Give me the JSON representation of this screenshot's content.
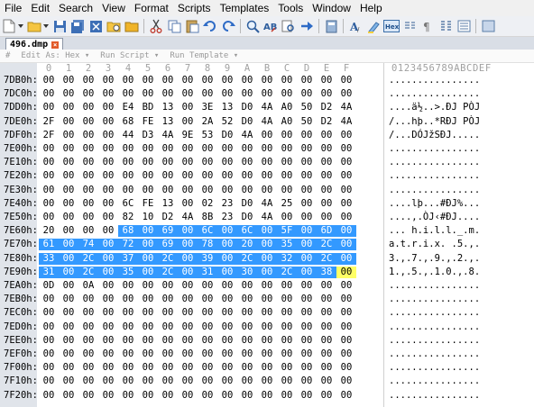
{
  "menu": [
    "File",
    "Edit",
    "Search",
    "View",
    "Format",
    "Scripts",
    "Templates",
    "Tools",
    "Window",
    "Help"
  ],
  "toolbar_icons": [
    "new-file-icon",
    "open-folder-icon",
    "save-icon",
    "save-all-icon",
    "close-file-icon",
    "open-recent-icon",
    "cut-icon",
    "copy-icon",
    "paste-icon",
    "undo-icon",
    "redo-icon",
    "find-icon",
    "replace-icon",
    "find-in-files-icon",
    "goto-icon",
    "calculator-icon",
    "font-icon",
    "highlight-icon",
    "hex-mode-icon",
    "text-mode-icon",
    "show-whitespace-icon",
    "columns-icon",
    "addresses-icon",
    "options-icon"
  ],
  "tab": {
    "label": "496.dmp"
  },
  "template_bar": {
    "edit_as": "Edit As: Hex",
    "run_script": "Run Script",
    "run_template": "Run Template"
  },
  "columns": [
    "0",
    "1",
    "2",
    "3",
    "4",
    "5",
    "6",
    "7",
    "8",
    "9",
    "A",
    "B",
    "C",
    "D",
    "E",
    "F"
  ],
  "ascii_header": "0123456789ABCDEF",
  "rows": [
    {
      "addr": "7DB0h:",
      "bytes": [
        "00",
        "00",
        "00",
        "00",
        "00",
        "00",
        "00",
        "00",
        "00",
        "00",
        "00",
        "00",
        "00",
        "00",
        "00",
        "00"
      ],
      "ascii": "................"
    },
    {
      "addr": "7DC0h:",
      "bytes": [
        "00",
        "00",
        "00",
        "00",
        "00",
        "00",
        "00",
        "00",
        "00",
        "00",
        "00",
        "00",
        "00",
        "00",
        "00",
        "00"
      ],
      "ascii": "................"
    },
    {
      "addr": "7DD0h:",
      "bytes": [
        "00",
        "00",
        "00",
        "00",
        "E4",
        "BD",
        "13",
        "00",
        "3E",
        "13",
        "D0",
        "4A",
        "A0",
        "50",
        "D2",
        "4A"
      ],
      "ascii": "....ä½..>.ÐJ PÒJ"
    },
    {
      "addr": "7DE0h:",
      "bytes": [
        "2F",
        "00",
        "00",
        "00",
        "68",
        "FE",
        "13",
        "00",
        "2A",
        "52",
        "D0",
        "4A",
        "A0",
        "50",
        "D2",
        "4A"
      ],
      "ascii": "/...hþ..*RÐJ PÒJ"
    },
    {
      "addr": "7DF0h:",
      "bytes": [
        "2F",
        "00",
        "00",
        "00",
        "44",
        "D3",
        "4A",
        "9E",
        "53",
        "D0",
        "4A",
        "00",
        "00",
        "00",
        "00",
        "00"
      ],
      "ascii": "/...DÓJžSÐJ....."
    },
    {
      "addr": "7E00h:",
      "bytes": [
        "00",
        "00",
        "00",
        "00",
        "00",
        "00",
        "00",
        "00",
        "00",
        "00",
        "00",
        "00",
        "00",
        "00",
        "00",
        "00"
      ],
      "ascii": "................"
    },
    {
      "addr": "7E10h:",
      "bytes": [
        "00",
        "00",
        "00",
        "00",
        "00",
        "00",
        "00",
        "00",
        "00",
        "00",
        "00",
        "00",
        "00",
        "00",
        "00",
        "00"
      ],
      "ascii": "................"
    },
    {
      "addr": "7E20h:",
      "bytes": [
        "00",
        "00",
        "00",
        "00",
        "00",
        "00",
        "00",
        "00",
        "00",
        "00",
        "00",
        "00",
        "00",
        "00",
        "00",
        "00"
      ],
      "ascii": "................"
    },
    {
      "addr": "7E30h:",
      "bytes": [
        "00",
        "00",
        "00",
        "00",
        "00",
        "00",
        "00",
        "00",
        "00",
        "00",
        "00",
        "00",
        "00",
        "00",
        "00",
        "00"
      ],
      "ascii": "................"
    },
    {
      "addr": "7E40h:",
      "bytes": [
        "00",
        "00",
        "00",
        "00",
        "6C",
        "FE",
        "13",
        "00",
        "02",
        "23",
        "D0",
        "4A",
        "25",
        "00",
        "00",
        "00"
      ],
      "ascii": "....lþ...#ÐJ%..."
    },
    {
      "addr": "7E50h:",
      "bytes": [
        "00",
        "00",
        "00",
        "00",
        "82",
        "10",
        "D2",
        "4A",
        "8B",
        "23",
        "D0",
        "4A",
        "00",
        "00",
        "00",
        "00"
      ],
      "ascii": "....‚.ÒJ‹#ÐJ...."
    },
    {
      "addr": "7E60h:",
      "bytes": [
        "20",
        "00",
        "00",
        "00",
        "68",
        "00",
        "69",
        "00",
        "6C",
        "00",
        "6C",
        "00",
        "5F",
        "00",
        "6D",
        "00"
      ],
      "ascii": "... h.i.l.l._.m.",
      "sel_from": 4,
      "sel_to": 15
    },
    {
      "addr": "7E70h:",
      "bytes": [
        "61",
        "00",
        "74",
        "00",
        "72",
        "00",
        "69",
        "00",
        "78",
        "00",
        "20",
        "00",
        "35",
        "00",
        "2C",
        "00"
      ],
      "ascii": "a.t.r.i.x. .5.,.",
      "sel_from": 0,
      "sel_to": 15
    },
    {
      "addr": "7E80h:",
      "bytes": [
        "33",
        "00",
        "2C",
        "00",
        "37",
        "00",
        "2C",
        "00",
        "39",
        "00",
        "2C",
        "00",
        "32",
        "00",
        "2C",
        "00"
      ],
      "ascii": "3.,.7.,.9.,.2.,.",
      "sel_from": 0,
      "sel_to": 15
    },
    {
      "addr": "7E90h:",
      "bytes": [
        "31",
        "00",
        "2C",
        "00",
        "35",
        "00",
        "2C",
        "00",
        "31",
        "00",
        "30",
        "00",
        "2C",
        "00",
        "38",
        "00"
      ],
      "ascii": "1.,.5.,.1.0.,.8.",
      "sel_from": 0,
      "sel_to": 14,
      "cursor": 15
    },
    {
      "addr": "7EA0h:",
      "bytes": [
        "0D",
        "00",
        "0A",
        "00",
        "00",
        "00",
        "00",
        "00",
        "00",
        "00",
        "00",
        "00",
        "00",
        "00",
        "00",
        "00"
      ],
      "ascii": "................"
    },
    {
      "addr": "7EB0h:",
      "bytes": [
        "00",
        "00",
        "00",
        "00",
        "00",
        "00",
        "00",
        "00",
        "00",
        "00",
        "00",
        "00",
        "00",
        "00",
        "00",
        "00"
      ],
      "ascii": "................"
    },
    {
      "addr": "7EC0h:",
      "bytes": [
        "00",
        "00",
        "00",
        "00",
        "00",
        "00",
        "00",
        "00",
        "00",
        "00",
        "00",
        "00",
        "00",
        "00",
        "00",
        "00"
      ],
      "ascii": "................"
    },
    {
      "addr": "7ED0h:",
      "bytes": [
        "00",
        "00",
        "00",
        "00",
        "00",
        "00",
        "00",
        "00",
        "00",
        "00",
        "00",
        "00",
        "00",
        "00",
        "00",
        "00"
      ],
      "ascii": "................"
    },
    {
      "addr": "7EE0h:",
      "bytes": [
        "00",
        "00",
        "00",
        "00",
        "00",
        "00",
        "00",
        "00",
        "00",
        "00",
        "00",
        "00",
        "00",
        "00",
        "00",
        "00"
      ],
      "ascii": "................"
    },
    {
      "addr": "7EF0h:",
      "bytes": [
        "00",
        "00",
        "00",
        "00",
        "00",
        "00",
        "00",
        "00",
        "00",
        "00",
        "00",
        "00",
        "00",
        "00",
        "00",
        "00"
      ],
      "ascii": "................"
    },
    {
      "addr": "7F00h:",
      "bytes": [
        "00",
        "00",
        "00",
        "00",
        "00",
        "00",
        "00",
        "00",
        "00",
        "00",
        "00",
        "00",
        "00",
        "00",
        "00",
        "00"
      ],
      "ascii": "................"
    },
    {
      "addr": "7F10h:",
      "bytes": [
        "00",
        "00",
        "00",
        "00",
        "00",
        "00",
        "00",
        "00",
        "00",
        "00",
        "00",
        "00",
        "00",
        "00",
        "00",
        "00"
      ],
      "ascii": "................"
    },
    {
      "addr": "7F20h:",
      "bytes": [
        "00",
        "00",
        "00",
        "00",
        "00",
        "00",
        "00",
        "00",
        "00",
        "00",
        "00",
        "00",
        "00",
        "00",
        "00",
        "00"
      ],
      "ascii": "................"
    }
  ],
  "colors": {
    "selection": "#3399ff",
    "cursor": "#ffff66",
    "address_gutter": "#e0e4ea",
    "tab_close": "#e25b2a"
  }
}
